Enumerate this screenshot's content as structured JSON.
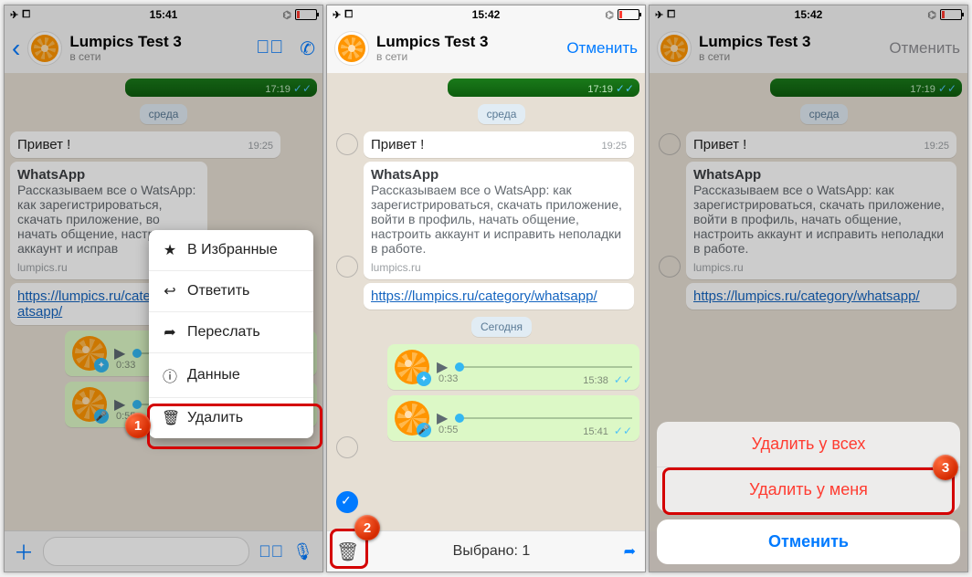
{
  "statusbar": {
    "t1": "15:41",
    "t2": "15:42",
    "t3": "15:42"
  },
  "header": {
    "name": "Lumpics Test 3",
    "sub": "в сети",
    "cancel": "Отменить"
  },
  "imgts": "17:19",
  "day1": "среда",
  "day2": "Сегодня",
  "greet": {
    "text": "Привет !",
    "ts": "19:25"
  },
  "preview": {
    "title": "WhatsApp",
    "desc": "Рассказываем все о WatsApp: как зарегистрироваться, скачать приложение, войти в профиль, начать общение, настроить аккаунт и исправить неполадки в работе.",
    "desc_short": "Рассказываем все о WatsApp: как зарегистрироваться, скачать приложение, войти в профиль, начать общение, настроить аккаунт и исправить неполадки в работе.",
    "desc_trunc": "Рассказываем все о WatsApp: как зарегистрироваться, скачать приложение, во",
    "desc_trunc2": "начать общение, настроить аккаунт и исправ",
    "src": "lumpics.ru"
  },
  "link": {
    "short": "https://lumpics.ru/category/whatsapp/",
    "full": "https://lumpics.ru/category/whatsapp/"
  },
  "voice1": {
    "dur": "0:33",
    "ts": "15:38"
  },
  "voice2": {
    "dur": "0:55",
    "ts": "15:41"
  },
  "ctx": {
    "fav": "В Избранные",
    "reply": "Ответить",
    "fwd": "Переслать",
    "info": "Данные",
    "del": "Удалить"
  },
  "selbar": {
    "label": "Выбрано: 1"
  },
  "sheet": {
    "all": "Удалить у всех",
    "me": "Удалить у меня",
    "cancel": "Отменить"
  },
  "nums": {
    "a": "1",
    "b": "2",
    "c": "3"
  }
}
